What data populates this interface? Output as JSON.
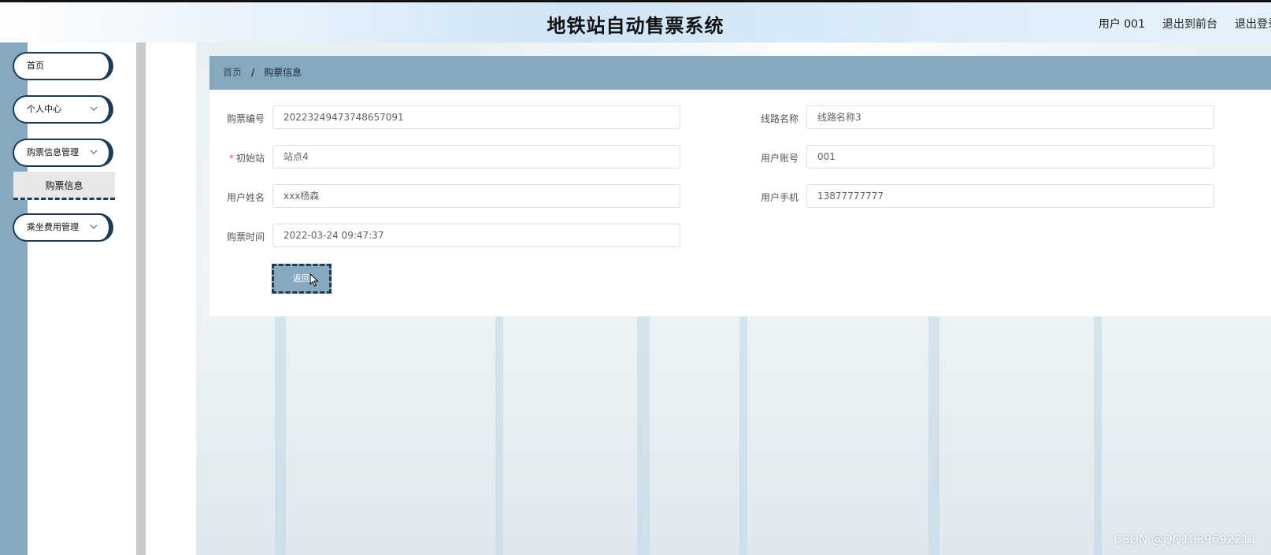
{
  "header": {
    "title": "地铁站自动售票系统",
    "links": [
      "用户 001",
      "退出到前台",
      "退出登录"
    ]
  },
  "sidebar": {
    "items": [
      {
        "label": "首页",
        "has_chevron": false
      },
      {
        "label": "个人中心",
        "has_chevron": true
      },
      {
        "label": "购票信息管理",
        "has_chevron": true
      },
      {
        "label": "乘坐费用管理",
        "has_chevron": true
      }
    ],
    "active_submenu": "购票信息"
  },
  "breadcrumb": {
    "home": "首页",
    "separator": "/",
    "current": "购票信息"
  },
  "form": {
    "ticket_no_label": "购票编号",
    "ticket_no_value": "20223249473748657091",
    "route_name_label": "线路名称",
    "route_name_value": "线路名称3",
    "start_station_required": "*",
    "start_station_label": "初始站",
    "start_station_value": "站点4",
    "user_account_label": "用户账号",
    "user_account_value": "001",
    "user_name_label": "用户姓名",
    "user_name_value": "xxx杨森",
    "user_phone_label": "用户手机",
    "user_phone_value": "13877777777",
    "purchase_time_label": "购票时间",
    "purchase_time_value": "2022-03-24 09:47:37",
    "back_label": "返回"
  },
  "watermark": "CSDN @QQ1039692211",
  "colors": {
    "accent": "#86a9c0",
    "dark_border": "#1f3b55"
  },
  "icons": {
    "chevron": "chevron-down-icon",
    "cursor": "mouse-pointer-icon"
  }
}
